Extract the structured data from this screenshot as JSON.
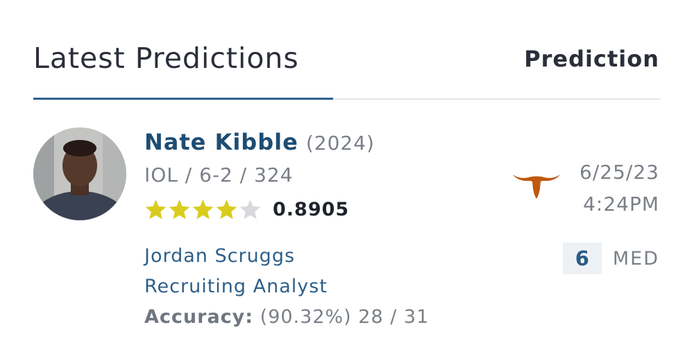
{
  "header": {
    "title": "Latest Predictions",
    "column_label": "Prediction"
  },
  "prediction": {
    "player": {
      "name": "Nate Kibble",
      "year": "(2024)",
      "details": "IOL / 6-2 / 324",
      "stars": 4,
      "max_stars": 5,
      "rating": "0.8905",
      "avatar_icon": "player-photo"
    },
    "analyst": {
      "name": "Jordan Scruggs",
      "title": "Recruiting Analyst",
      "accuracy_label": "Accuracy:",
      "accuracy_value": "(90.32%) 28 / 31"
    },
    "team": {
      "logo_icon": "longhorn-icon",
      "color": "#c0580f"
    },
    "date": "6/25/23",
    "time": "4:24PM",
    "confidence": {
      "score": "6",
      "label": "MED"
    }
  },
  "colors": {
    "accent": "#2f5e8e",
    "star_filled": "#d9cc1e",
    "star_empty": "#d7d9dc",
    "link": "#2d5f89",
    "muted": "#7a7f87"
  }
}
